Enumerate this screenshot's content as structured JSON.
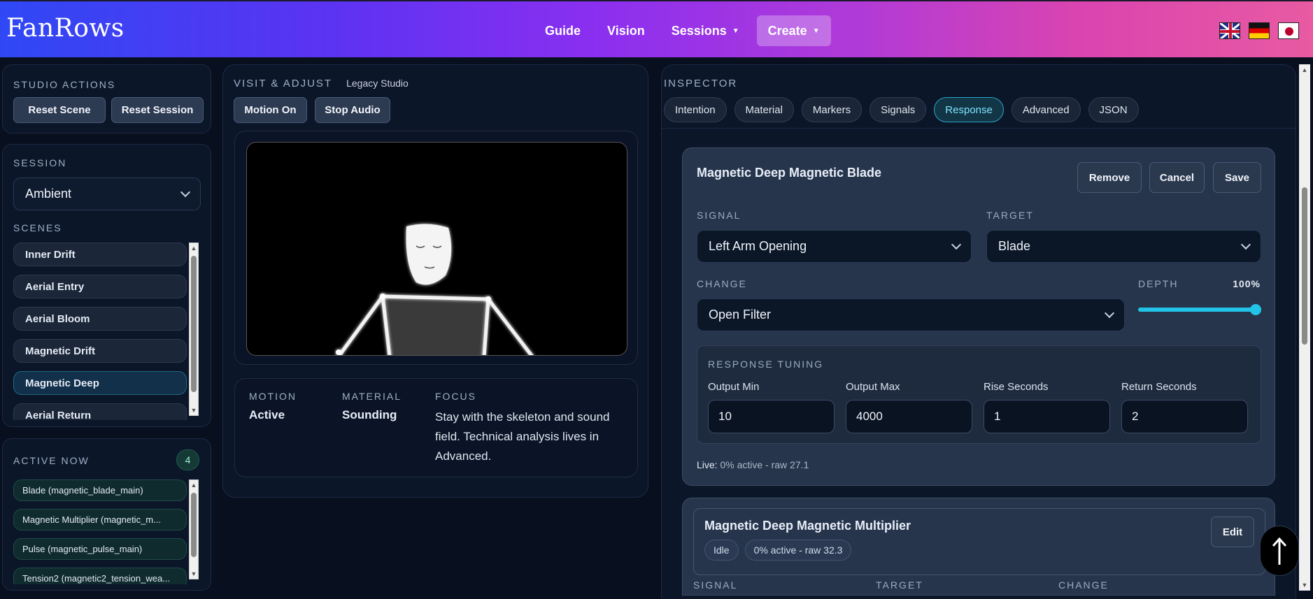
{
  "brand": "FanRows",
  "nav": {
    "guide": "Guide",
    "vision": "Vision",
    "sessions": "Sessions",
    "create": "Create"
  },
  "studio_actions": {
    "title": "STUDIO ACTIONS",
    "reset_scene": "Reset Scene",
    "reset_session": "Reset Session"
  },
  "session": {
    "title": "SESSION",
    "selected": "Ambient",
    "scenes_title": "SCENES",
    "scenes": [
      "Inner Drift",
      "Aerial Entry",
      "Aerial Bloom",
      "Magnetic Drift",
      "Magnetic Deep",
      "Aerial Return"
    ],
    "active_scene": "Magnetic Deep"
  },
  "active_now": {
    "title": "ACTIVE NOW",
    "count": "4",
    "items": [
      "Blade (magnetic_blade_main)",
      "Magnetic Multiplier (magnetic_m...",
      "Pulse (magnetic_pulse_main)",
      "Tension2 (magnetic2_tension_wea..."
    ]
  },
  "visit": {
    "title": "VISIT & ADJUST",
    "subtitle": "Legacy Studio",
    "motion_on": "Motion On",
    "stop_audio": "Stop Audio",
    "motion_label": "MOTION",
    "motion_value": "Active",
    "material_label": "MATERIAL",
    "material_value": "Sounding",
    "focus_label": "FOCUS",
    "focus_value": "Stay with the skeleton and sound field. Technical analysis lives in Advanced."
  },
  "inspector": {
    "title": "INSPECTOR",
    "tabs": [
      "Intention",
      "Material",
      "Markers",
      "Signals",
      "Response",
      "Advanced",
      "JSON"
    ],
    "active_tab": "Response"
  },
  "card1": {
    "title": "Magnetic Deep Magnetic Blade",
    "remove": "Remove",
    "cancel": "Cancel",
    "save": "Save",
    "signal_label": "SIGNAL",
    "signal_value": "Left Arm Opening",
    "target_label": "TARGET",
    "target_value": "Blade",
    "change_label": "CHANGE",
    "change_value": "Open Filter",
    "depth_label": "DEPTH",
    "depth_value": "100%",
    "depth_fraction": 1.0,
    "tuning_title": "RESPONSE TUNING",
    "output_min_label": "Output Min",
    "output_min": "10",
    "output_max_label": "Output Max",
    "output_max": "4000",
    "rise_label": "Rise Seconds",
    "rise": "1",
    "return_label": "Return Seconds",
    "return": "2",
    "live_label": "Live:",
    "live_value": "0% active - raw 27.1"
  },
  "card2": {
    "title": "Magnetic Deep Magnetic Multiplier",
    "status": "Idle",
    "live": "0% active - raw 32.3",
    "edit": "Edit",
    "signal_label": "SIGNAL",
    "target_label": "TARGET",
    "change_label": "CHANGE"
  },
  "icons": {
    "scroll_top": "arrow-up-icon"
  }
}
